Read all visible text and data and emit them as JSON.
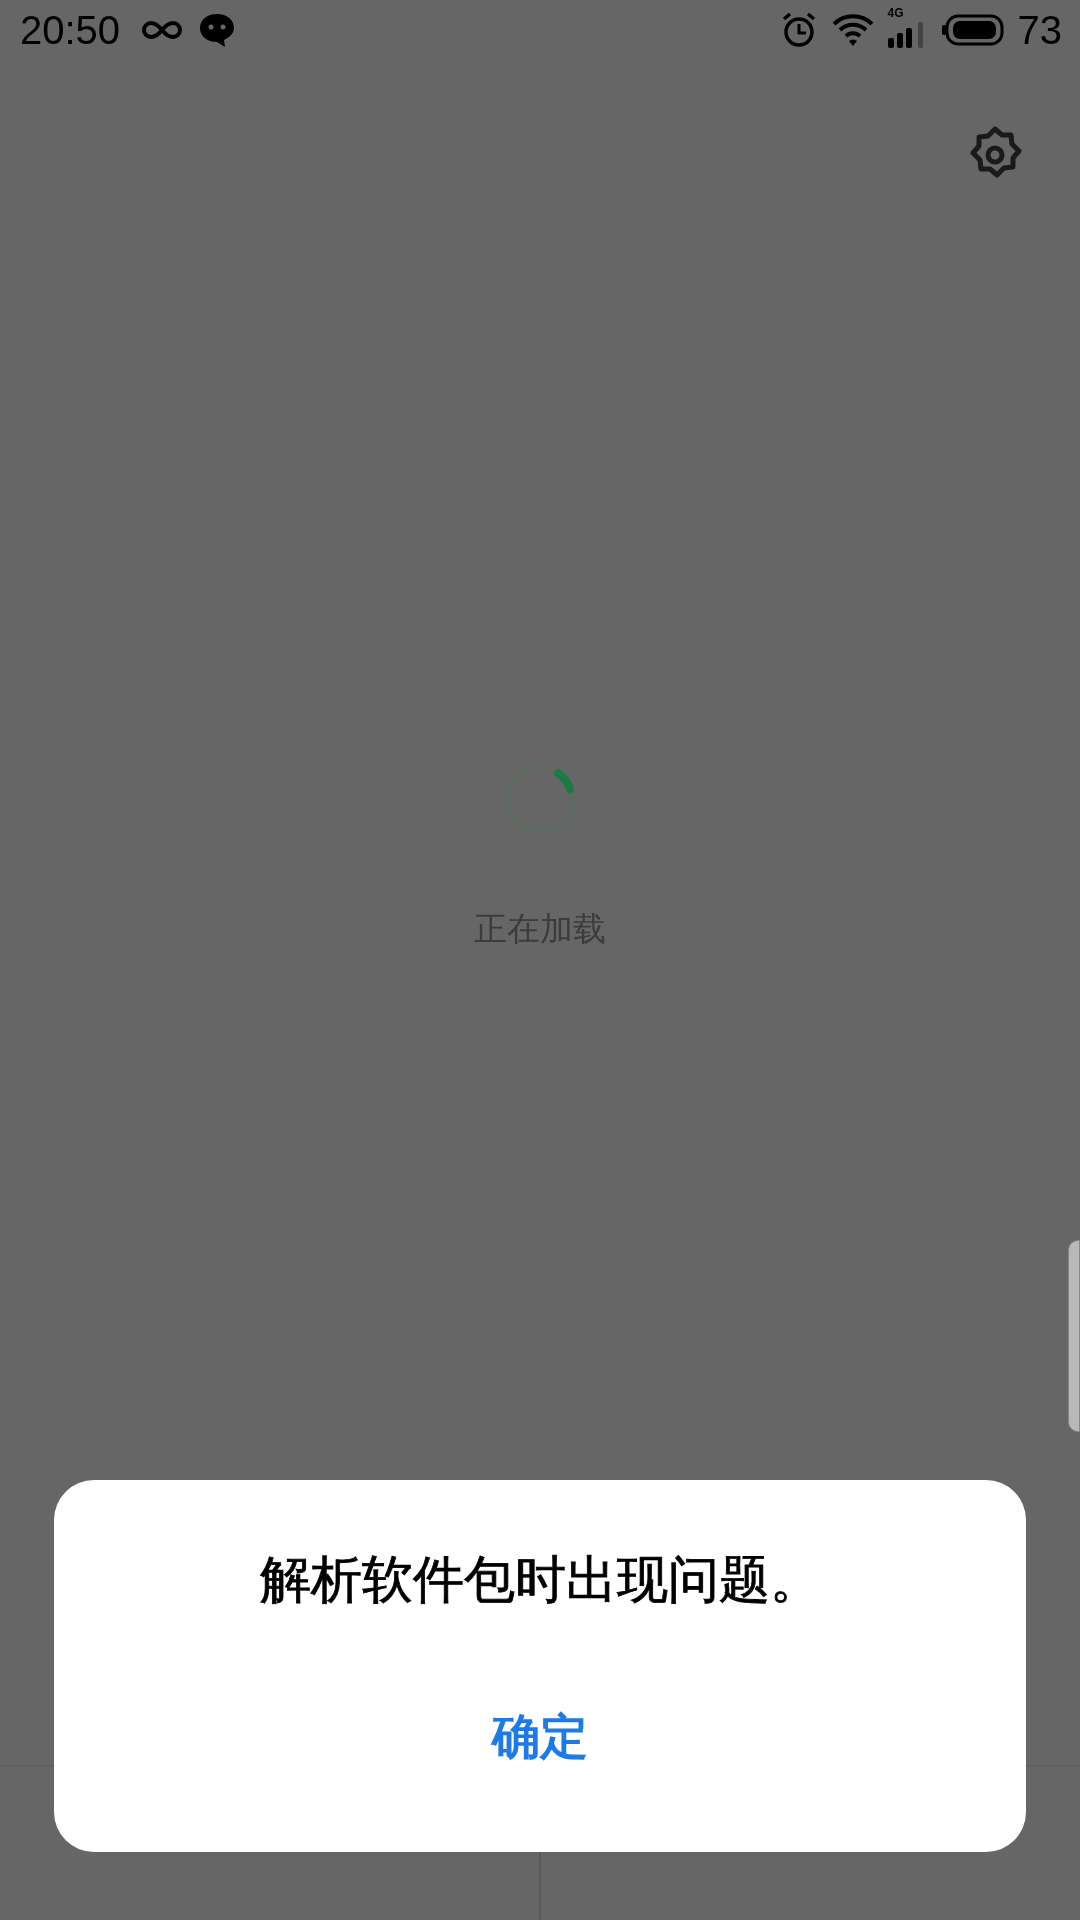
{
  "status_bar": {
    "time": "20:50",
    "network": "4G",
    "battery": "73"
  },
  "loading": {
    "text": "正在加载"
  },
  "dialog": {
    "message": "解析软件包时出现问题。",
    "button": "确定"
  }
}
